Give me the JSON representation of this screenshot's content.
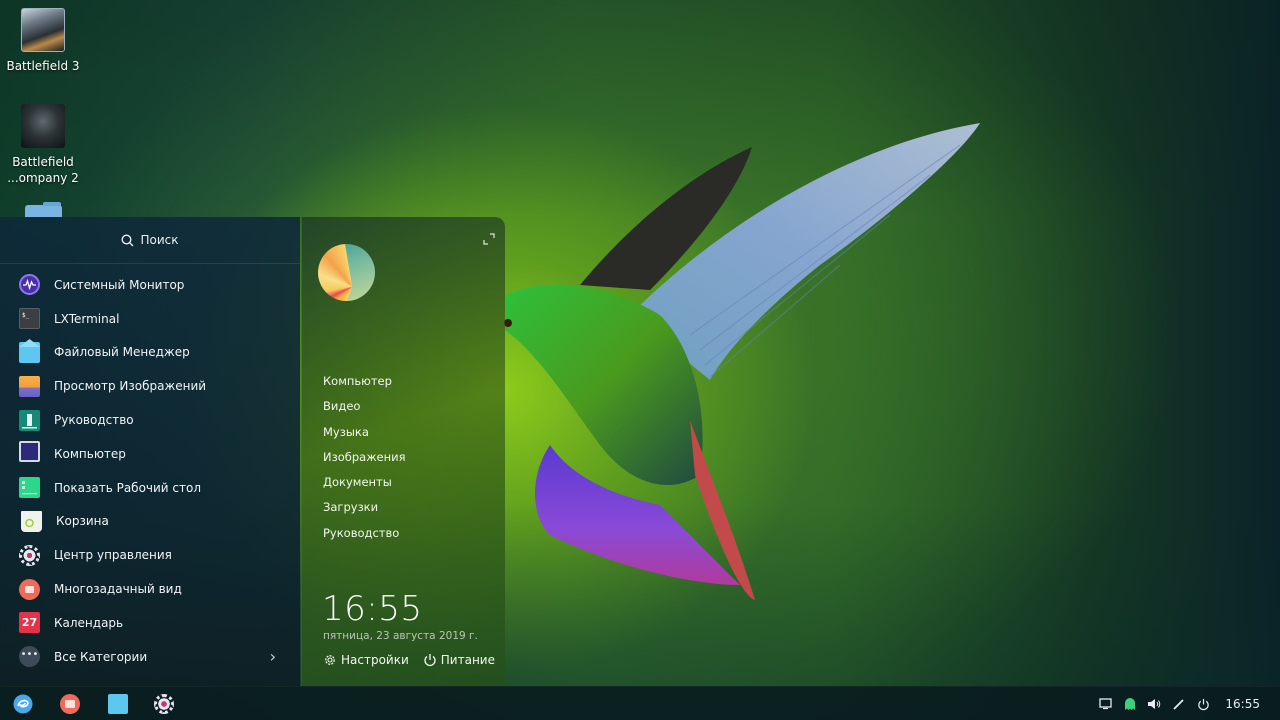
{
  "desktop": {
    "icons": [
      {
        "label": "Battlefield 3"
      },
      {
        "label_line1": "Battlefield",
        "label_line2": "...ompany 2"
      },
      {
        "label": ""
      }
    ]
  },
  "launcher": {
    "search": {
      "placeholder": "Поиск",
      "icon": "search-icon"
    },
    "apps": [
      {
        "label": "Системный Монитор",
        "icon": "system-monitor-icon"
      },
      {
        "label": "LXTerminal",
        "icon": "terminal-icon"
      },
      {
        "label": "Файловый Менеджер",
        "icon": "file-manager-icon"
      },
      {
        "label": "Просмотр Изображений",
        "icon": "image-viewer-icon"
      },
      {
        "label": "Руководство",
        "icon": "manual-icon"
      },
      {
        "label": "Компьютер",
        "icon": "computer-icon"
      },
      {
        "label": "Показать Рабочий стол",
        "icon": "show-desktop-icon"
      },
      {
        "label": "Корзина",
        "icon": "trash-icon"
      },
      {
        "label": "Центр управления",
        "icon": "control-center-icon"
      },
      {
        "label": "Многозадачный вид",
        "icon": "multitask-view-icon"
      },
      {
        "label": "Календарь",
        "icon": "calendar-icon",
        "badge": "27"
      }
    ],
    "all_categories": {
      "label": "Все Категории",
      "dots": "•••",
      "chevron": "›"
    },
    "places": [
      "Компьютер",
      "Видео",
      "Музыка",
      "Изображения",
      "Документы",
      "Загрузки",
      "Руководство"
    ],
    "clock": "16:55",
    "date": "пятница, 23 августа 2019 г.",
    "settings_label": "Настройки",
    "power_label": "Питание"
  },
  "dock": {
    "items": [
      "launcher-icon",
      "multitask-view-icon",
      "file-manager-icon",
      "control-center-icon"
    ]
  },
  "tray": {
    "items": [
      "notification-icon",
      "ghost-icon",
      "volume-icon",
      "pen-icon",
      "shutdown-icon"
    ],
    "time": "16:55"
  },
  "colors": {
    "accent_purple": "#4b2fa8",
    "calendar_red": "#e2334a",
    "multitask_coral": "#f06a5a",
    "files_cyan": "#5ec7f0",
    "ghost_green": "#3ecf7a"
  }
}
